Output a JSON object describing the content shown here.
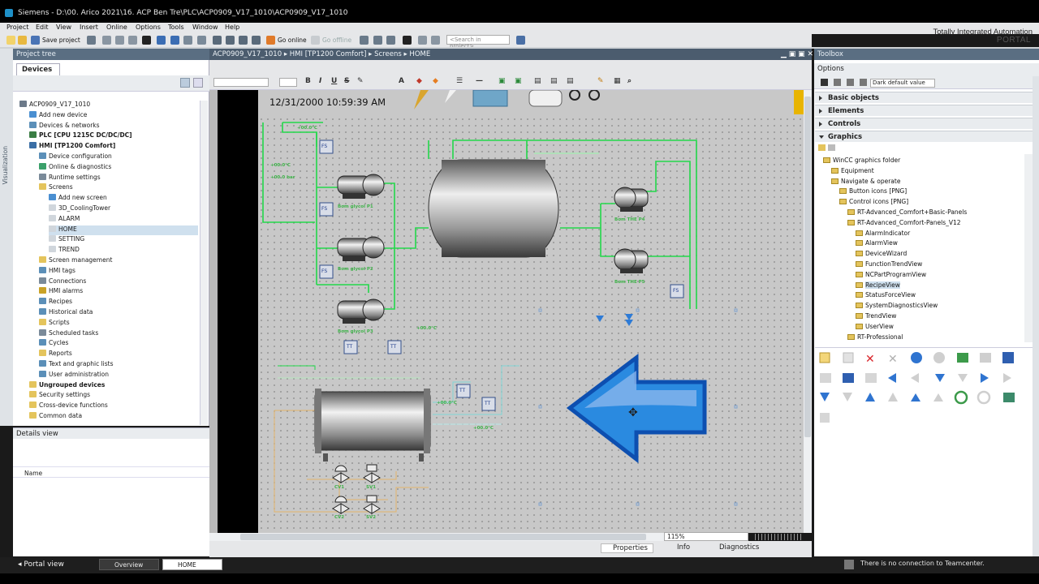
{
  "window": {
    "title": "Siemens  -  D:\\00. Arico 2021\\16. ACP Ben Tre\\PLC\\ACP0909_V17_1010\\ACP0909_V17_1010"
  },
  "menu": [
    "Project",
    "Edit",
    "View",
    "Insert",
    "Online",
    "Options",
    "Tools",
    "Window",
    "Help"
  ],
  "brand": {
    "line1": "Totally Integrated Automation",
    "line2": "PORTAL"
  },
  "toolbar": {
    "save_label": "Save project",
    "go_online": "Go online",
    "go_offline": "Go offline",
    "search_placeholder": "<Search in project>"
  },
  "project_tree": {
    "title": "Project tree",
    "tab": "Devices",
    "side_label": "Visualization",
    "items": [
      {
        "label": "ACP0909_V17_1010",
        "indent": 0,
        "icon": "#6c7a89"
      },
      {
        "label": "Add new device",
        "indent": 1,
        "icon": "#4a8fd1"
      },
      {
        "label": "Devices & networks",
        "indent": 1,
        "icon": "#5b8fb8"
      },
      {
        "label": "PLC [CPU 1215C DC/DC/DC]",
        "indent": 1,
        "icon": "#3a7d44",
        "bold": true
      },
      {
        "label": "HMI [TP1200 Comfort]",
        "indent": 1,
        "icon": "#3a6ea5",
        "bold": true
      },
      {
        "label": "Device configuration",
        "indent": 2,
        "icon": "#5b8fb8"
      },
      {
        "label": "Online & diagnostics",
        "indent": 2,
        "icon": "#3aa06a"
      },
      {
        "label": "Runtime settings",
        "indent": 2,
        "icon": "#7a8a99"
      },
      {
        "label": "Screens",
        "indent": 2,
        "icon": "#e4c45c"
      },
      {
        "label": "Add new screen",
        "indent": 3,
        "icon": "#4a8fd1"
      },
      {
        "label": "3D_CoolingTower",
        "indent": 3,
        "icon": "#d0d6dc"
      },
      {
        "label": "ALARM",
        "indent": 3,
        "icon": "#d0d6dc"
      },
      {
        "label": "HOME",
        "indent": 3,
        "icon": "#d0d6dc",
        "selected": true
      },
      {
        "label": "SETTING",
        "indent": 3,
        "icon": "#d0d6dc"
      },
      {
        "label": "TREND",
        "indent": 3,
        "icon": "#d0d6dc"
      },
      {
        "label": "Screen management",
        "indent": 2,
        "icon": "#e4c45c"
      },
      {
        "label": "HMI tags",
        "indent": 2,
        "icon": "#5b8fb8"
      },
      {
        "label": "Connections",
        "indent": 2,
        "icon": "#7a8a99"
      },
      {
        "label": "HMI alarms",
        "indent": 2,
        "icon": "#c9a227"
      },
      {
        "label": "Recipes",
        "indent": 2,
        "icon": "#5b8fb8"
      },
      {
        "label": "Historical data",
        "indent": 2,
        "icon": "#5b8fb8"
      },
      {
        "label": "Scripts",
        "indent": 2,
        "icon": "#e4c45c"
      },
      {
        "label": "Scheduled tasks",
        "indent": 2,
        "icon": "#7a8a99"
      },
      {
        "label": "Cycles",
        "indent": 2,
        "icon": "#5b8fb8"
      },
      {
        "label": "Reports",
        "indent": 2,
        "icon": "#e4c45c"
      },
      {
        "label": "Text and graphic lists",
        "indent": 2,
        "icon": "#5b8fb8"
      },
      {
        "label": "User administration",
        "indent": 2,
        "icon": "#5b8fb8"
      },
      {
        "label": "Ungrouped devices",
        "indent": 1,
        "icon": "#e4c45c",
        "bold": true
      },
      {
        "label": "Security settings",
        "indent": 1,
        "icon": "#e4c45c"
      },
      {
        "label": "Cross-device functions",
        "indent": 1,
        "icon": "#e4c45c"
      },
      {
        "label": "Common data",
        "indent": 1,
        "icon": "#e4c45c"
      }
    ]
  },
  "details_view": {
    "title": "Details view",
    "column": "Name"
  },
  "editor": {
    "breadcrumb": "ACP0909_V17_1010  ▸  HMI [TP1200 Comfort]  ▸  Screens  ▸  HOME",
    "datetime": "12/31/2000  10:59:39 AM",
    "zoom": "115%",
    "labels": {
      "p1": "Bơm glycol P1",
      "p2": "Bơm glycol P2",
      "p3": "Bơm glycol P3",
      "p4": "Bơm THE P4",
      "p5": "Bơm THE P5",
      "cv1": "CV1",
      "sv1": "SV1",
      "cv2": "CV2",
      "sv2": "SV2",
      "fs": "FS",
      "tt": "TT",
      "val_temp": "+00.0°C",
      "val_bar": "+00.0 bar"
    }
  },
  "bottom_tabs": {
    "properties": "Properties",
    "info": "Info",
    "diagnostics": "Diagnostics"
  },
  "toolbox": {
    "title": "Toolbox",
    "options": "Options",
    "style": "Dark default value",
    "sections": [
      "Basic objects",
      "Elements",
      "Controls",
      "Graphics"
    ],
    "graphics_tree": [
      {
        "label": "WinCC graphics folder",
        "indent": 0
      },
      {
        "label": "Equipment",
        "indent": 1
      },
      {
        "label": "Navigate & operate",
        "indent": 1
      },
      {
        "label": "Button icons [PNG]",
        "indent": 2
      },
      {
        "label": "Control icons [PNG]",
        "indent": 2
      },
      {
        "label": "RT-Advanced_Comfort+Basic-Panels",
        "indent": 3
      },
      {
        "label": "RT-Advanced_Comfort-Panels_V12",
        "indent": 3
      },
      {
        "label": "AlarmIndicator",
        "indent": 4
      },
      {
        "label": "AlarmView",
        "indent": 4
      },
      {
        "label": "DeviceWizard",
        "indent": 4
      },
      {
        "label": "FunctionTrendView",
        "indent": 4
      },
      {
        "label": "NCPartProgramView",
        "indent": 4
      },
      {
        "label": "RecipeView",
        "indent": 4,
        "selected": true
      },
      {
        "label": "StatusForceView",
        "indent": 4
      },
      {
        "label": "SystemDiagnosticsView",
        "indent": 4
      },
      {
        "label": "TrendView",
        "indent": 4
      },
      {
        "label": "UserView",
        "indent": 4
      },
      {
        "label": "RT-Professional",
        "indent": 3
      }
    ]
  },
  "statusbar": {
    "portal_view": "Portal view",
    "overview": "Overview",
    "home": "HOME",
    "teamcenter": "There is no connection to Teamcenter."
  },
  "colors": {
    "pipe_green": "#22d84a",
    "arrow_blue": "#1c7fd6",
    "tag_blue": "#35508a"
  }
}
